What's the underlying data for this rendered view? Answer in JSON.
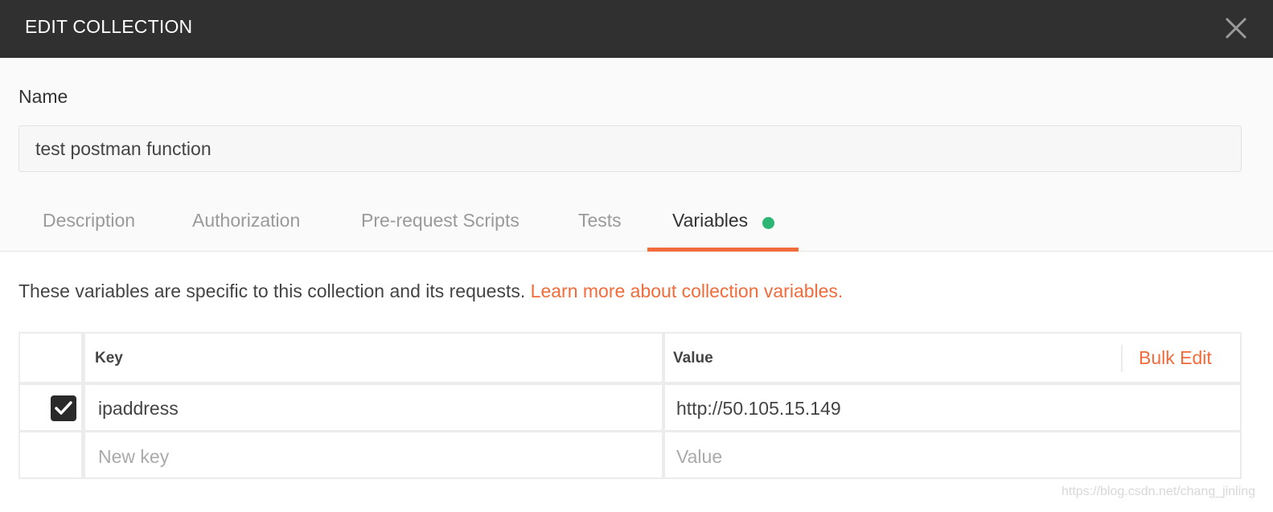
{
  "window": {
    "title": "EDIT COLLECTION",
    "close_icon": "close-icon"
  },
  "name_section": {
    "label": "Name",
    "value": "test postman function"
  },
  "tabs": [
    {
      "label": "Description",
      "active": false
    },
    {
      "label": "Authorization",
      "active": false
    },
    {
      "label": "Pre-request Scripts",
      "active": false
    },
    {
      "label": "Tests",
      "active": false
    },
    {
      "label": "Variables",
      "active": true,
      "indicator": "green-dot"
    }
  ],
  "variables": {
    "description": "These variables are specific to this collection and its requests.",
    "learn_more_link": "Learn more about collection variables.",
    "table": {
      "headers": {
        "key": "Key",
        "value": "Value"
      },
      "bulk_edit": "Bulk Edit",
      "rows": [
        {
          "checked": true,
          "key": "ipaddress",
          "value": "http://50.105.15.149"
        }
      ],
      "new_row": {
        "key_placeholder": "New key",
        "value_placeholder": "Value"
      }
    }
  },
  "watermark": "https://blog.csdn.net/chang_jinling",
  "colors": {
    "titlebar": "#303030",
    "accent": "#f26b3a",
    "indicator": "#2bb673",
    "checkbox": "#2a2a2a"
  }
}
